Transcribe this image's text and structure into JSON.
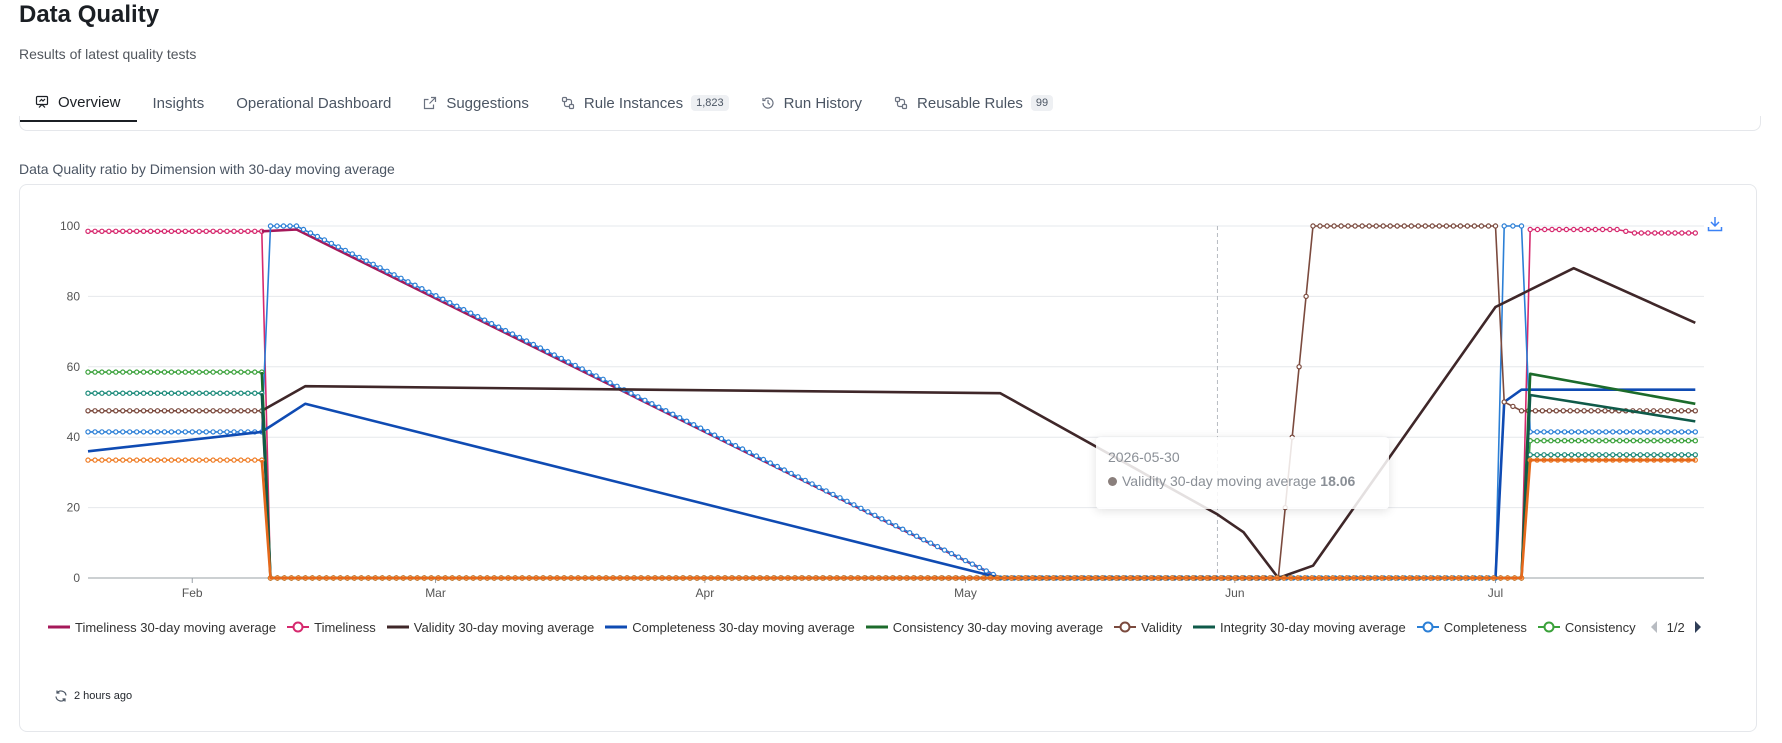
{
  "header": {
    "title": "Data Quality",
    "subtitle": "Results of latest quality tests"
  },
  "tabs": [
    {
      "label": "Overview",
      "icon": "presentation-chart-icon",
      "active": true
    },
    {
      "label": "Insights",
      "active": false
    },
    {
      "label": "Operational Dashboard",
      "active": false
    },
    {
      "label": "Suggestions",
      "icon": "external-link-icon",
      "active": false
    },
    {
      "label": "Rule Instances",
      "icon": "compare-icon",
      "badge": "1,823",
      "active": false
    },
    {
      "label": "Run History",
      "icon": "history-icon",
      "active": false
    },
    {
      "label": "Reusable Rules",
      "icon": "compare-icon",
      "badge": "99",
      "active": false
    }
  ],
  "section": {
    "title": "Data Quality ratio by Dimension with 30-day moving average"
  },
  "tooltip": {
    "date": "2026-05-30",
    "series": "Validity 30-day moving average",
    "value": "18.06"
  },
  "legend": {
    "items": [
      {
        "label": "Timeliness 30-day moving average",
        "color": "#a5185a",
        "style": "line"
      },
      {
        "label": "Timeliness",
        "color": "#d6296e",
        "style": "circle"
      },
      {
        "label": "Validity 30-day moving average",
        "color": "#3f2729",
        "style": "line"
      },
      {
        "label": "Completeness 30-day moving average",
        "color": "#0f4bb3",
        "style": "line"
      },
      {
        "label": "Consistency 30-day moving average",
        "color": "#1c6b2b",
        "style": "line"
      },
      {
        "label": "Validity",
        "color": "#7b4a3e",
        "style": "circle"
      },
      {
        "label": "Integrity 30-day moving average",
        "color": "#0f5a49",
        "style": "line"
      },
      {
        "label": "Completeness",
        "color": "#2b7fd6",
        "style": "circle"
      },
      {
        "label": "Consistency",
        "color": "#3aa13a",
        "style": "circle"
      }
    ],
    "page": "1/2"
  },
  "refresh": {
    "label": "2 hours ago"
  },
  "chart_data": {
    "type": "line",
    "x_axis": {
      "type": "date",
      "range": [
        "2026-01-20",
        "2026-07-25"
      ],
      "ticks": [
        "Feb",
        "Mar",
        "Apr",
        "May",
        "Jun",
        "Jul"
      ]
    },
    "y_axis": {
      "ticks": [
        "0",
        "20",
        "40",
        "60",
        "80",
        "100"
      ],
      "ylim": [
        0,
        100
      ]
    },
    "grid": true,
    "legend_position": "bottom",
    "hover_date": "2026-05-30",
    "series": [
      {
        "name": "Timeliness",
        "kind": "markers",
        "color": "#d6296e",
        "points": [
          [
            "2026-01-20",
            98.5
          ],
          [
            "2026-02-09",
            98.5
          ],
          [
            "2026-02-10",
            0
          ],
          [
            "2026-07-04",
            0
          ],
          [
            "2026-07-05",
            99
          ],
          [
            "2026-07-15",
            99
          ],
          [
            "2026-07-17",
            98
          ],
          [
            "2026-07-24",
            98
          ]
        ]
      },
      {
        "name": "Timeliness 30-day moving average",
        "kind": "line",
        "color": "#a5185a",
        "points": [
          [
            "2026-02-09",
            98.5
          ],
          [
            "2026-02-13",
            99
          ],
          [
            "2026-05-05",
            0
          ]
        ]
      },
      {
        "name": "Completeness",
        "kind": "markers",
        "color": "#2b7fd6",
        "points": [
          [
            "2026-01-20",
            41.5
          ],
          [
            "2026-02-09",
            41.5
          ],
          [
            "2026-02-10",
            100
          ],
          [
            "2026-02-13",
            100
          ],
          [
            "2026-05-05",
            0
          ],
          [
            "2026-07-01",
            0
          ],
          [
            "2026-07-02",
            100
          ],
          [
            "2026-07-04",
            100
          ],
          [
            "2026-07-05",
            41.5
          ],
          [
            "2026-07-24",
            41.5
          ]
        ]
      },
      {
        "name": "Completeness 30-day moving average",
        "kind": "line",
        "color": "#0f4bb3",
        "points": [
          [
            "2026-01-20",
            36
          ],
          [
            "2026-02-09",
            41.5
          ],
          [
            "2026-02-14",
            49.5
          ],
          [
            "2026-05-05",
            0
          ],
          [
            "2026-07-01",
            0
          ],
          [
            "2026-07-02",
            50
          ],
          [
            "2026-07-04",
            53.5
          ],
          [
            "2026-07-24",
            53.5
          ]
        ]
      },
      {
        "name": "Validity",
        "kind": "markers",
        "color": "#7b4a3e",
        "points": [
          [
            "2026-01-20",
            47.5
          ],
          [
            "2026-02-09",
            47.5
          ],
          [
            "2026-02-10",
            0
          ],
          [
            "2026-06-06",
            0
          ],
          [
            "2026-06-10",
            100
          ],
          [
            "2026-07-01",
            100
          ],
          [
            "2026-07-02",
            50
          ],
          [
            "2026-07-04",
            47.5
          ],
          [
            "2026-07-24",
            47.5
          ]
        ]
      },
      {
        "name": "Validity 30-day moving average",
        "kind": "line",
        "color": "#3f2729",
        "points": [
          [
            "2026-02-09",
            47.5
          ],
          [
            "2026-02-14",
            54.5
          ],
          [
            "2026-05-05",
            52.5
          ],
          [
            "2026-05-30",
            18.06
          ],
          [
            "2026-06-02",
            13
          ],
          [
            "2026-06-06",
            0
          ],
          [
            "2026-06-10",
            3.5
          ],
          [
            "2026-07-01",
            77
          ],
          [
            "2026-07-10",
            88
          ],
          [
            "2026-07-24",
            72.5
          ]
        ]
      },
      {
        "name": "Consistency",
        "kind": "markers",
        "color": "#3aa13a",
        "points": [
          [
            "2026-01-20",
            58.5
          ],
          [
            "2026-02-09",
            58.5
          ],
          [
            "2026-02-10",
            0
          ],
          [
            "2026-07-04",
            0
          ],
          [
            "2026-07-05",
            39
          ],
          [
            "2026-07-24",
            39
          ]
        ]
      },
      {
        "name": "Consistency 30-day moving average",
        "kind": "line",
        "color": "#1c6b2b",
        "points": [
          [
            "2026-02-09",
            58.5
          ],
          [
            "2026-02-10",
            0
          ],
          [
            "2026-07-04",
            0
          ],
          [
            "2026-07-05",
            58
          ],
          [
            "2026-07-24",
            49.5
          ]
        ]
      },
      {
        "name": "Integrity",
        "kind": "markers",
        "color": "#1f8c7c",
        "points": [
          [
            "2026-01-20",
            52.5
          ],
          [
            "2026-02-09",
            52.5
          ],
          [
            "2026-02-10",
            0
          ],
          [
            "2026-07-04",
            0
          ],
          [
            "2026-07-05",
            35
          ],
          [
            "2026-07-24",
            35
          ]
        ]
      },
      {
        "name": "Integrity 30-day moving average",
        "kind": "line",
        "color": "#0f5a49",
        "points": [
          [
            "2026-02-09",
            52.5
          ],
          [
            "2026-02-10",
            0
          ],
          [
            "2026-07-04",
            0
          ],
          [
            "2026-07-05",
            52
          ],
          [
            "2026-07-24",
            44.5
          ]
        ]
      },
      {
        "kind": "markers",
        "color": "#ef7c24",
        "points": [
          [
            "2026-01-20",
            33.5
          ],
          [
            "2026-02-09",
            33.5
          ],
          [
            "2026-02-10",
            0
          ],
          [
            "2026-07-04",
            0
          ],
          [
            "2026-07-05",
            33.5
          ],
          [
            "2026-07-24",
            33.5
          ]
        ]
      },
      {
        "kind": "line",
        "color": "#e5681b",
        "points": [
          [
            "2026-02-09",
            33.5
          ],
          [
            "2026-02-10",
            0
          ],
          [
            "2026-07-04",
            0
          ],
          [
            "2026-07-05",
            33.5
          ],
          [
            "2026-07-24",
            33.5
          ]
        ]
      }
    ]
  }
}
